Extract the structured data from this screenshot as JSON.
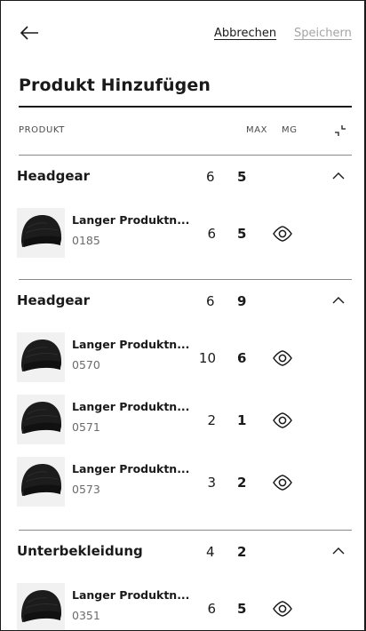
{
  "header": {
    "back_icon": "arrow-left-icon",
    "cancel_label": "Abbrechen",
    "save_label": "Speichern"
  },
  "page_title": "Produkt Hinzufügen",
  "columns": {
    "product": "PRODUKT",
    "max": "MAX",
    "mg": "MG",
    "collapse_icon": "collapse-icon"
  },
  "groups": [
    {
      "name": "Headgear",
      "max": "6",
      "mg": "5",
      "items": [
        {
          "name": "Langer Produktn...",
          "code": "0185",
          "max": "6",
          "mg": "5"
        }
      ]
    },
    {
      "name": "Headgear",
      "max": "6",
      "mg": "9",
      "items": [
        {
          "name": "Langer Produktn...",
          "code": "0570",
          "max": "10",
          "mg": "6"
        },
        {
          "name": "Langer Produktn...",
          "code": "0571",
          "max": "2",
          "mg": "1"
        },
        {
          "name": "Langer Produktn...",
          "code": "0573",
          "max": "3",
          "mg": "2"
        }
      ]
    },
    {
      "name": "Unterbekleidung",
      "max": "4",
      "mg": "2",
      "items": [
        {
          "name": "Langer Produktn...",
          "code": "0351",
          "max": "6",
          "mg": "5"
        }
      ]
    }
  ],
  "colors": {
    "text": "#1a1a1a",
    "muted": "#6b6b6b",
    "disabled": "#a5a5a5"
  }
}
